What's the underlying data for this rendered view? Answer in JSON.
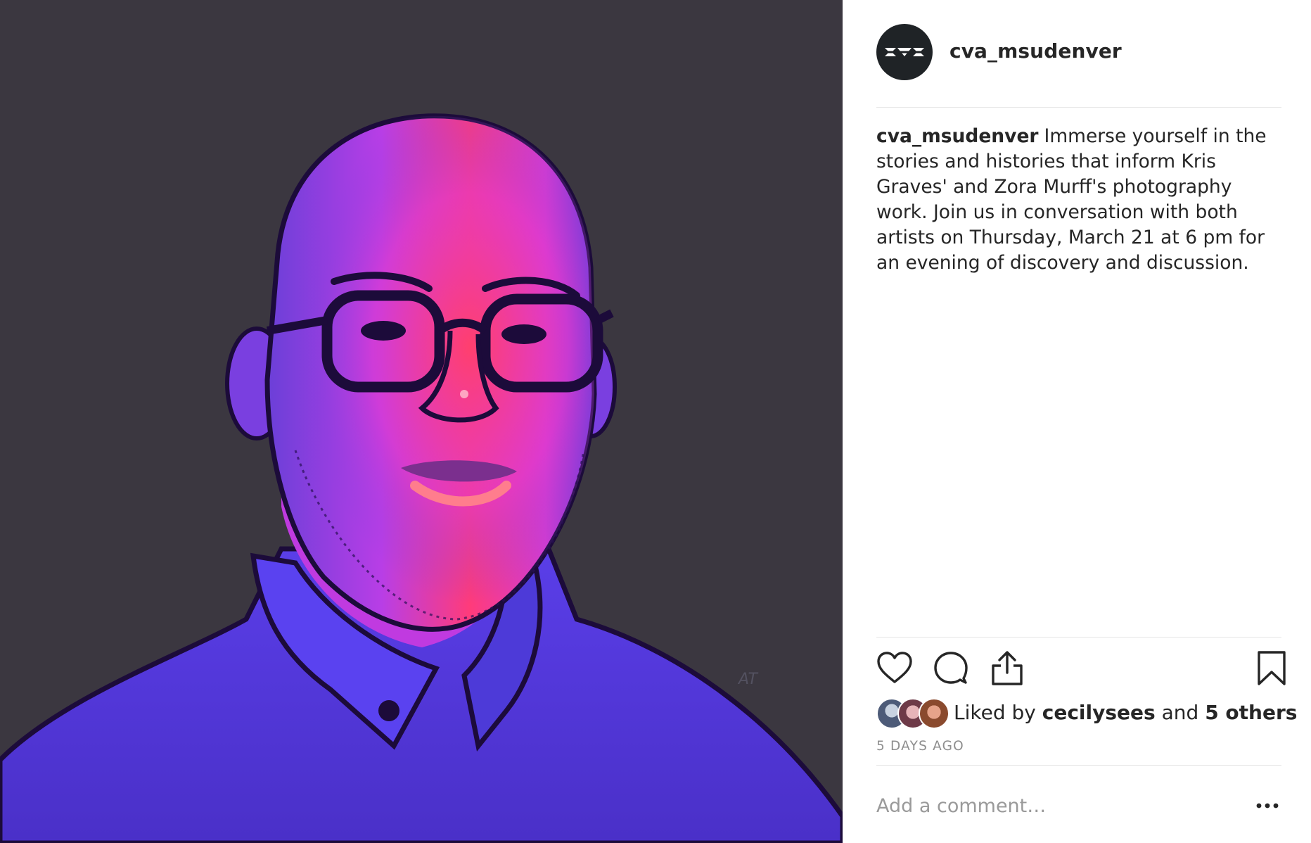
{
  "post": {
    "username": "cva_msudenver",
    "avatar_logo_text": "CVA",
    "image_signature": "AT",
    "caption": {
      "username": "cva_msudenver",
      "text": "Immerse yourself in the stories and histories that inform Kris Graves' and Zora Murff's photography work. Join us in conversation with both artists on Thursday, March 21 at 6 pm for an evening of discovery and discussion."
    },
    "actions": {
      "like_icon": "heart-outline-icon",
      "comment_icon": "speech-bubble-icon",
      "share_icon": "share-upload-icon",
      "save_icon": "bookmark-outline-icon"
    },
    "likes": {
      "prefix": "Liked by",
      "first_liker": "cecilysees",
      "connector": "and",
      "others": "5 others"
    },
    "timestamp": "5 DAYS AGO",
    "comment": {
      "placeholder": "Add a comment…",
      "more_icon": "ellipsis-icon"
    }
  },
  "colors": {
    "media_background": "#3b3740",
    "text_primary": "#262626",
    "text_secondary": "#8e8e8e",
    "divider": "#e6e6e6",
    "avatar_background": "#1f2326"
  }
}
